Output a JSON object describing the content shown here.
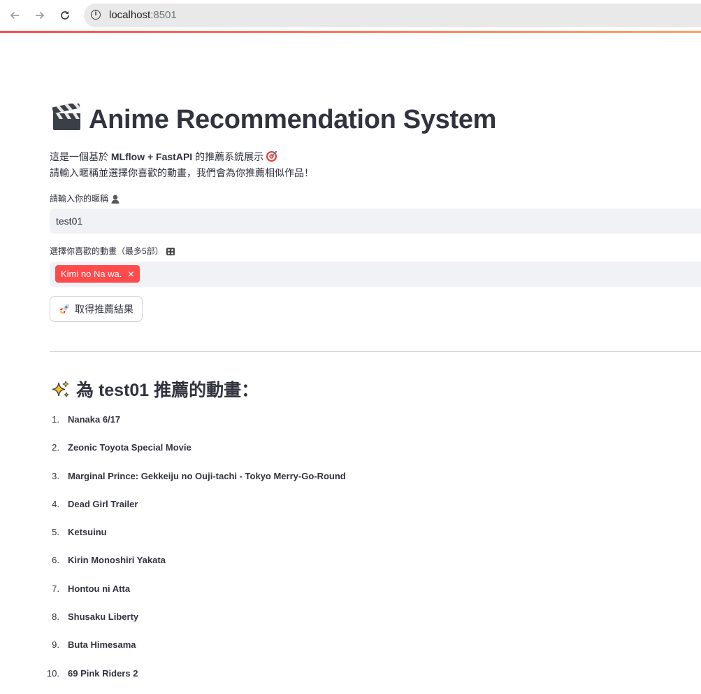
{
  "browser": {
    "url_host": "localhost",
    "url_port": ":8501"
  },
  "app": {
    "title": "Anime Recommendation System",
    "desc_line1_prefix": "這是一個基於 ",
    "desc_line1_bold": "MLflow + FastAPI",
    "desc_line1_suffix": " 的推薦系統展示",
    "desc_line2": "請輸入暱稱並選擇你喜歡的動畫，我們會為你推薦相似作品！",
    "nickname_label": "請輸入你的暱稱",
    "nickname_value": "test01",
    "anime_label": "選擇你喜歡的動畫（最多5部）",
    "selected_anime": [
      "Kimi no Na wa."
    ],
    "submit_label": "取得推薦結果",
    "rec_heading": "為 test01 推薦的動畫：",
    "recommendations": [
      "Nanaka 6/17",
      "Zeonic Toyota Special Movie",
      "Marginal Prince: Gekkeiju no Ouji-tachi - Tokyo Merry-Go-Round",
      "Dead Girl Trailer",
      "Ketsuinu",
      "Kirin Monoshiri Yakata",
      "Hontou ni Atta",
      "Shusaku Liberty",
      "Buta Himesama",
      "69 Pink Riders 2"
    ]
  },
  "icons": {
    "title_icon": "clapperboard-icon",
    "desc_icon": "target-icon",
    "nickname_icon": "person-icon",
    "anime_icon": "film-reel-icon",
    "button_icon": "rocket-icon",
    "heading_icon": "sparkles-icon"
  },
  "colors": {
    "accent": "#ff4b4b",
    "input_bg": "#f0f2f6",
    "text": "#31333f"
  }
}
